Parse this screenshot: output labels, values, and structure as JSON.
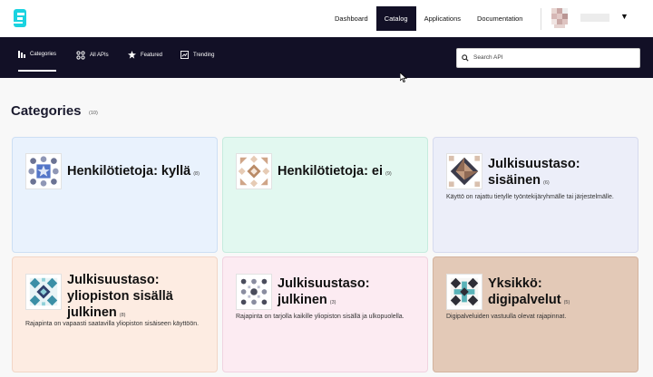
{
  "topnav": {
    "items": [
      {
        "label": "Dashboard",
        "active": false
      },
      {
        "label": "Catalog",
        "active": true
      },
      {
        "label": "Applications",
        "active": false
      },
      {
        "label": "Documentation",
        "active": false
      }
    ]
  },
  "subnav": {
    "tabs": [
      {
        "label": "Categories",
        "icon": "categories-icon",
        "active": true
      },
      {
        "label": "All APIs",
        "icon": "all-apis-icon",
        "active": false
      },
      {
        "label": "Featured",
        "icon": "featured-icon",
        "active": false
      },
      {
        "label": "Trending",
        "icon": "trending-icon",
        "active": false
      }
    ],
    "search_placeholder": "Search API"
  },
  "page": {
    "heading": "Categories",
    "count": "(10)"
  },
  "cards": [
    {
      "title": "Henkilötietoja: kyllä",
      "count": "(8)",
      "description": "",
      "bg": "#e9f2fd",
      "border": "#cddff4",
      "icon": "pattern-blue-star-icon"
    },
    {
      "title": "Henkilötietoja: ei",
      "count": "(9)",
      "description": "",
      "bg": "#e2f8f0",
      "border": "#c6ebde",
      "icon": "pattern-tan-pinwheel-icon"
    },
    {
      "title": "Julkisuustaso: sisäinen",
      "count": "(6)",
      "description": "Käyttö on rajattu tietylle työntekijäryhmälle tai järjestelmälle.",
      "bg": "#eceef9",
      "border": "#d6daee",
      "icon": "pattern-brown-diamond-icon"
    },
    {
      "title": "Julkisuustaso: yliopiston sisällä julkinen",
      "count": "(8)",
      "description": "Rajapinta on vapaasti saatavilla yliopiston sisäiseen käyttöön.",
      "bg": "#fdece2",
      "border": "#f2d6c6",
      "icon": "pattern-teal-grid-icon"
    },
    {
      "title": "Julkisuustaso: julkinen",
      "count": "(3)",
      "description": "Rajapinta on tarjolla kaikille yliopiston sisällä ja ulkopuolella.",
      "bg": "#fcebf2",
      "border": "#f0d3e0",
      "icon": "pattern-dots-icon"
    },
    {
      "title": "Yksikkö: digipalvelut",
      "count": "(5)",
      "description": "Digipalveluiden vastuulla olevat rajapinnat.",
      "bg": "#e3c9b7",
      "border": "#d3b39e",
      "icon": "pattern-cross-icon"
    }
  ]
}
